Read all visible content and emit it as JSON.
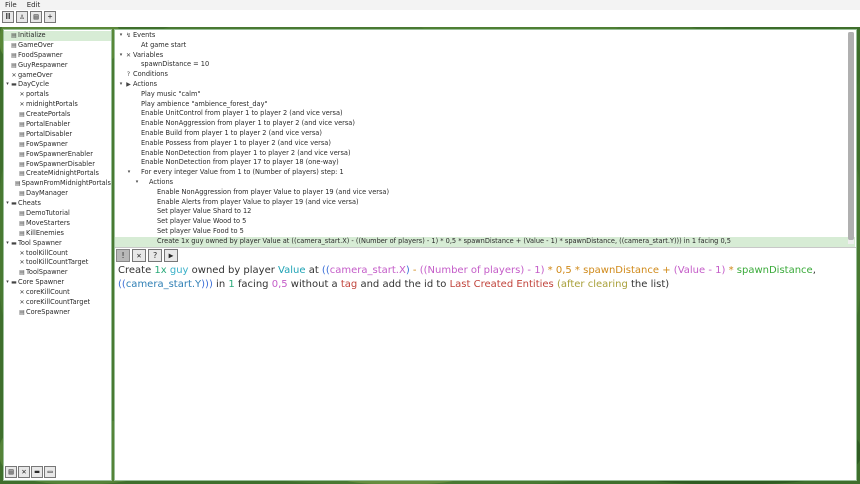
{
  "menu": [
    "File",
    "Edit"
  ],
  "toolbar_buttons": [
    {
      "name": "columns-icon",
      "glyph": "Ⅲ"
    },
    {
      "name": "unit-icon",
      "glyph": "♙"
    },
    {
      "name": "document-icon",
      "glyph": "▤"
    },
    {
      "name": "add-icon",
      "glyph": "+"
    }
  ],
  "tree": [
    {
      "label": "Initialize",
      "depth": 0,
      "kind": "trigger",
      "sel": true
    },
    {
      "label": "GameOver",
      "depth": 0,
      "kind": "trigger"
    },
    {
      "label": "FoodSpawner",
      "depth": 0,
      "kind": "trigger"
    },
    {
      "label": "GuyRespawner",
      "depth": 0,
      "kind": "trigger"
    },
    {
      "label": "gameOver",
      "depth": 0,
      "kind": "var"
    },
    {
      "label": "DayCycle",
      "depth": 0,
      "kind": "folder",
      "open": true
    },
    {
      "label": "portals",
      "depth": 1,
      "kind": "var"
    },
    {
      "label": "midnightPortals",
      "depth": 1,
      "kind": "var"
    },
    {
      "label": "CreatePortals",
      "depth": 1,
      "kind": "trigger"
    },
    {
      "label": "PortalEnabler",
      "depth": 1,
      "kind": "trigger"
    },
    {
      "label": "PortalDisabler",
      "depth": 1,
      "kind": "trigger"
    },
    {
      "label": "FowSpawner",
      "depth": 1,
      "kind": "trigger"
    },
    {
      "label": "FowSpawnerEnabler",
      "depth": 1,
      "kind": "trigger"
    },
    {
      "label": "FowSpawnerDisabler",
      "depth": 1,
      "kind": "trigger"
    },
    {
      "label": "CreateMidnightPortals",
      "depth": 1,
      "kind": "trigger"
    },
    {
      "label": "SpawnFromMidnightPortals",
      "depth": 1,
      "kind": "trigger"
    },
    {
      "label": "DayManager",
      "depth": 1,
      "kind": "trigger"
    },
    {
      "label": "Cheats",
      "depth": 0,
      "kind": "folder",
      "open": true
    },
    {
      "label": "DemoTutorial",
      "depth": 1,
      "kind": "trigger"
    },
    {
      "label": "MoveStarters",
      "depth": 1,
      "kind": "trigger"
    },
    {
      "label": "KillEnemies",
      "depth": 1,
      "kind": "trigger"
    },
    {
      "label": "Tool Spawner",
      "depth": 0,
      "kind": "folder",
      "open": true
    },
    {
      "label": "toolKillCount",
      "depth": 1,
      "kind": "var"
    },
    {
      "label": "toolKillCountTarget",
      "depth": 1,
      "kind": "var"
    },
    {
      "label": "ToolSpawner",
      "depth": 1,
      "kind": "trigger"
    },
    {
      "label": "Core Spawner",
      "depth": 0,
      "kind": "folder",
      "open": true
    },
    {
      "label": "coreKillCount",
      "depth": 1,
      "kind": "var"
    },
    {
      "label": "coreKillCountTarget",
      "depth": 1,
      "kind": "var"
    },
    {
      "label": "CoreSpawner",
      "depth": 1,
      "kind": "trigger"
    }
  ],
  "tree_bottom_buttons": [
    {
      "name": "new-trigger-icon",
      "glyph": "▤"
    },
    {
      "name": "delete-icon",
      "glyph": "✕"
    },
    {
      "name": "folder-icon",
      "glyph": "▬"
    },
    {
      "name": "comment-icon",
      "glyph": "▭"
    }
  ],
  "editor_rows": [
    {
      "label": "Events",
      "depth": 0,
      "tw": "▾",
      "ic": "↯"
    },
    {
      "label": "At game start",
      "depth": 1,
      "tw": "",
      "ic": ""
    },
    {
      "label": "Variables",
      "depth": 0,
      "tw": "▾",
      "ic": "✕"
    },
    {
      "label": "spawnDistance = 10",
      "depth": 1,
      "tw": "",
      "ic": ""
    },
    {
      "label": "Conditions",
      "depth": 0,
      "tw": "",
      "ic": "?"
    },
    {
      "label": "Actions",
      "depth": 0,
      "tw": "▾",
      "ic": "▶"
    },
    {
      "label": "Play music \"calm\"",
      "depth": 1,
      "tw": "",
      "ic": ""
    },
    {
      "label": "Play ambience \"ambience_forest_day\"",
      "depth": 1,
      "tw": "",
      "ic": ""
    },
    {
      "label": "Enable UnitControl from player 1 to player 2 (and vice versa)",
      "depth": 1,
      "tw": "",
      "ic": ""
    },
    {
      "label": "Enable NonAggression from player 1 to player 2 (and vice versa)",
      "depth": 1,
      "tw": "",
      "ic": ""
    },
    {
      "label": "Enable Build from player 1 to player 2 (and vice versa)",
      "depth": 1,
      "tw": "",
      "ic": ""
    },
    {
      "label": "Enable Possess from player 1 to player 2 (and vice versa)",
      "depth": 1,
      "tw": "",
      "ic": ""
    },
    {
      "label": "Enable NonDetection from player 1 to player 2 (and vice versa)",
      "depth": 1,
      "tw": "",
      "ic": ""
    },
    {
      "label": "Enable NonDetection from player 17 to player 18 (one-way)",
      "depth": 1,
      "tw": "",
      "ic": ""
    },
    {
      "label": "For every integer Value from 1 to (Number of players) step: 1",
      "depth": 1,
      "tw": "▾",
      "ic": ""
    },
    {
      "label": "Actions",
      "depth": 2,
      "tw": "▾",
      "ic": ""
    },
    {
      "label": "Enable NonAggression from player Value to player 19 (and vice versa)",
      "depth": 3,
      "tw": "",
      "ic": ""
    },
    {
      "label": "Enable Alerts from player Value to player 19 (and vice versa)",
      "depth": 3,
      "tw": "",
      "ic": ""
    },
    {
      "label": "Set player Value Shard to 12",
      "depth": 3,
      "tw": "",
      "ic": ""
    },
    {
      "label": "Set player Value Wood to 5",
      "depth": 3,
      "tw": "",
      "ic": ""
    },
    {
      "label": "Set player Value Food to 5",
      "depth": 3,
      "tw": "",
      "ic": ""
    },
    {
      "label": "Create 1x guy owned by player Value at ((camera_start.X) - ((Number of players) - 1) * 0,5 * spawnDistance + (Value - 1) * spawnDistance, ((camera_start.Y))) in 1 facing 0,5",
      "depth": 3,
      "tw": "",
      "ic": "",
      "sel": true
    }
  ],
  "editor_toolbar": [
    {
      "name": "warning-icon",
      "glyph": "!",
      "disabled": true
    },
    {
      "name": "close-icon",
      "glyph": "✕"
    },
    {
      "name": "help-icon",
      "glyph": "?"
    },
    {
      "name": "run-icon",
      "glyph": "▶"
    }
  ],
  "action_text": [
    {
      "t": "Create ",
      "c": ""
    },
    {
      "t": "1x",
      "c": "c-num"
    },
    {
      "t": " ",
      "c": ""
    },
    {
      "t": "guy",
      "c": "c-obj"
    },
    {
      "t": " owned by player ",
      "c": ""
    },
    {
      "t": "Value",
      "c": "c-var"
    },
    {
      "t": " at ",
      "c": ""
    },
    {
      "t": "((",
      "c": "c-paren1"
    },
    {
      "t": "camera_start.X",
      "c": "c-paren2"
    },
    {
      "t": ")",
      "c": "c-paren1"
    },
    {
      "t": " - ",
      "c": "c-op"
    },
    {
      "t": "((",
      "c": "c-paren2"
    },
    {
      "t": "Number of players",
      "c": "c-paren2"
    },
    {
      "t": ") - ",
      "c": "c-paren2"
    },
    {
      "t": "1",
      "c": "c-paren2"
    },
    {
      "t": ")",
      "c": "c-paren2"
    },
    {
      "t": " * ",
      "c": "c-op"
    },
    {
      "t": "0,5",
      "c": "c-op"
    },
    {
      "t": " * ",
      "c": "c-op"
    },
    {
      "t": "spawnDistance",
      "c": "c-op"
    },
    {
      "t": " + ",
      "c": "c-op"
    },
    {
      "t": "(",
      "c": "c-paren2"
    },
    {
      "t": "Value",
      "c": "c-paren2"
    },
    {
      "t": " - ",
      "c": "c-paren2"
    },
    {
      "t": "1",
      "c": "c-paren2"
    },
    {
      "t": ")",
      "c": "c-paren2"
    },
    {
      "t": " * ",
      "c": "c-op"
    },
    {
      "t": "spawnDistance",
      "c": "c-green"
    },
    {
      "t": ", ",
      "c": ""
    },
    {
      "t": "((",
      "c": "c-paren1"
    },
    {
      "t": "camera_start.Y",
      "c": "c-func"
    },
    {
      "t": "))",
      "c": "c-paren1"
    },
    {
      "t": ")",
      "c": "c-paren1"
    },
    {
      "t": " in ",
      "c": ""
    },
    {
      "t": "1",
      "c": "c-num"
    },
    {
      "t": " facing ",
      "c": ""
    },
    {
      "t": "0,5",
      "c": "c-paren2"
    },
    {
      "t": " without a ",
      "c": ""
    },
    {
      "t": "tag",
      "c": "c-name"
    },
    {
      "t": " and add the id to ",
      "c": ""
    },
    {
      "t": "Last Created Entities",
      "c": "c-name"
    },
    {
      "t": " (",
      "c": "c-dis"
    },
    {
      "t": "after clearing",
      "c": "c-dis"
    },
    {
      "t": " the list)",
      "c": ""
    }
  ],
  "colors": {
    "selection": "#d7ecd5",
    "panel_border": "#9ac09a",
    "background": "#3f6f2c"
  }
}
